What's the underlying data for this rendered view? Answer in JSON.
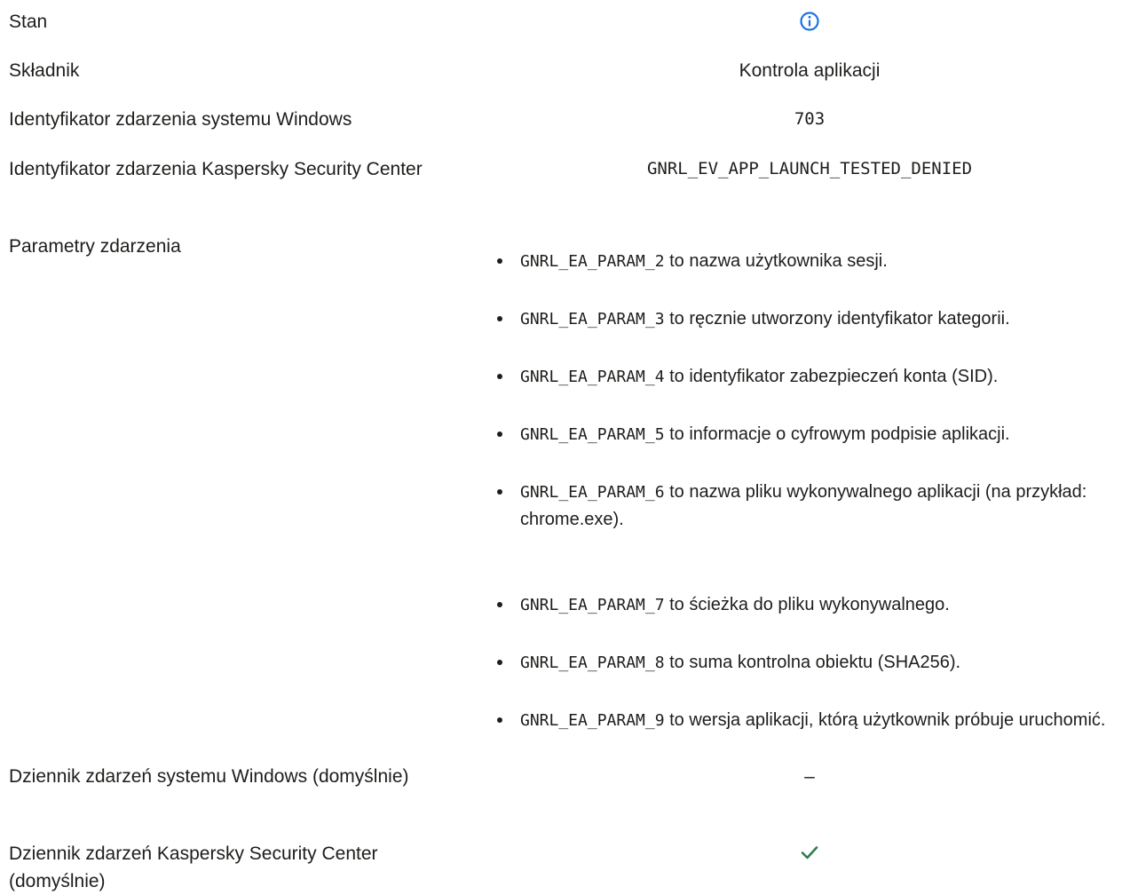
{
  "rows": {
    "stan": {
      "label": "Stan",
      "icon": "info-icon",
      "icon_color": "#1a73e8"
    },
    "skladnik": {
      "label": "Składnik",
      "value": "Kontrola aplikacji"
    },
    "win_event_id": {
      "label": "Identyfikator zdarzenia systemu Windows",
      "value": "703"
    },
    "ksc_event_id": {
      "label": "Identyfikator zdarzenia Kaspersky Security Center",
      "value": "GNRL_EV_APP_LAUNCH_TESTED_DENIED"
    },
    "params": {
      "label": "Parametry zdarzenia",
      "items": [
        {
          "code": "GNRL_EA_PARAM_2",
          "text": " to nazwa użytkownika sesji."
        },
        {
          "code": "GNRL_EA_PARAM_3",
          "text": " to ręcznie utworzony identyfikator kategorii."
        },
        {
          "code": "GNRL_EA_PARAM_4",
          "text": " to identyfikator zabezpieczeń konta (SID)."
        },
        {
          "code": "GNRL_EA_PARAM_5",
          "text": " to informacje o cyfrowym podpisie aplikacji."
        },
        {
          "code": "GNRL_EA_PARAM_6",
          "text": " to nazwa pliku wykonywalnego aplikacji (na przykład: chrome.exe)."
        },
        {
          "code": "GNRL_EA_PARAM_7",
          "text": " to ścieżka do pliku wykonywalnego."
        },
        {
          "code": "GNRL_EA_PARAM_8",
          "text": " to suma kontrolna obiektu (SHA256)."
        },
        {
          "code": "GNRL_EA_PARAM_9",
          "text": " to wersja aplikacji, którą użytkownik próbuje uruchomić."
        }
      ]
    },
    "win_log": {
      "label": "Dziennik zdarzeń systemu Windows (domyślnie)",
      "value": "–"
    },
    "ksc_log": {
      "label": "Dziennik zdarzeń Kaspersky Security Center (domyślnie)",
      "icon": "check-icon",
      "icon_color": "#2e7d4f"
    }
  }
}
